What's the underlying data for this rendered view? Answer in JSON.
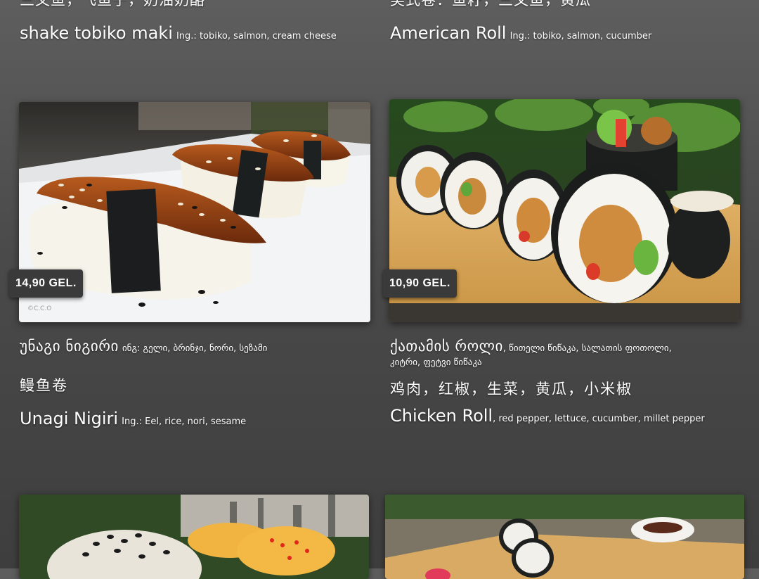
{
  "top_row": {
    "left_cut_chinese": "三文鱼，飞鱼子，奶油奶酪",
    "left_name": "shake tobiko maki",
    "left_ing": "Ing.: tobiko, salmon, cream cheese",
    "right_cut_chinese": "美式卷：鱼籽，三文鱼，黄瓜",
    "right_name": "American Roll",
    "right_ing": "Ing.: tobiko, salmon, cucumber"
  },
  "items": [
    {
      "price": "14,90 GEL.",
      "georgian_name": "უნაგი ნიგირი",
      "georgian_ing": "ინგ: გელი, ბრინჯი, ნორი, სეზამი",
      "chinese": "鳗鱼卷",
      "name": "Unagi Nigiri",
      "ing": "Ing.: Eel, rice, nori, sesame"
    },
    {
      "price": "10,90 GEL.",
      "georgian_name": "ქათამის როლი",
      "georgian_ing_1": ", წითელი წიწაკა, სალათის ფოთოლი,",
      "georgian_ing_2": "კიტრი, ფეტვი წიწაკა",
      "chinese": "鸡肉，红椒，生菜，黄瓜，小米椒",
      "name": "Chicken Roll",
      "ing": ", red pepper, lettuce, cucumber, millet pepper"
    }
  ],
  "photo_watermark": "©C.C.O",
  "icons": [
    "unagi-nigiri-photo",
    "chicken-roll-photo",
    "sesame-roll-photo",
    "roll-platter-photo"
  ]
}
